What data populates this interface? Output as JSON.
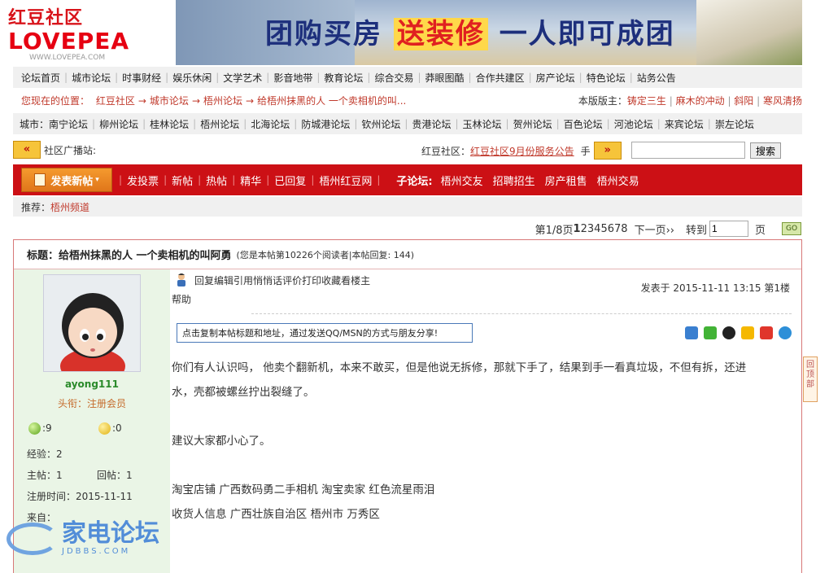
{
  "site": {
    "logo_cn": "红豆社区",
    "logo_en": "LOVEPEA",
    "logo_url": "WWW.LOVEPEA.COM"
  },
  "banner": {
    "slogan_a": "团购买房",
    "slogan_hl": "送装修",
    "slogan_b": "一人即可成团"
  },
  "main_nav": [
    "论坛首页",
    "城市论坛",
    "时事财经",
    "娱乐休闲",
    "文学艺术",
    "影音地带",
    "教育论坛",
    "综合交易",
    "莽眼图酷",
    "合作共建区",
    "房产论坛",
    "特色论坛",
    "站务公告"
  ],
  "breadcrumb": {
    "prefix": "您现在的位置：",
    "items": [
      "红豆社区",
      "城市论坛",
      "梧州论坛",
      "给梧州抹黑的人 一个卖相机的叫..."
    ],
    "arrow": "→",
    "moderator_label": "本版版主：",
    "moderators": [
      "铸定三生",
      "麻木的冲动",
      "斜阳",
      "寒风清扬"
    ]
  },
  "city_nav": {
    "label": "城市：",
    "items": [
      "南宁论坛",
      "柳州论坛",
      "桂林论坛",
      "梧州论坛",
      "北海论坛",
      "防城港论坛",
      "钦州论坛",
      "贵港论坛",
      "玉林论坛",
      "贺州论坛",
      "百色论坛",
      "河池论坛",
      "来宾论坛",
      "崇左论坛"
    ]
  },
  "broadcast": {
    "label": "社区广播站:",
    "right_label": "红豆社区：",
    "announcement": "红豆社区9月份服务公告",
    "hand": "手",
    "search_placeholder": "",
    "search_button": "搜索"
  },
  "toolbar": {
    "post_button": "发表新帖",
    "items": [
      "发投票",
      "新帖",
      "热帖",
      "精华",
      "已回复",
      "梧州红豆网"
    ],
    "sub_label": "子论坛:",
    "sub_items": [
      "梧州交友",
      "招聘招生",
      "房产租售",
      "梧州交易"
    ]
  },
  "recommend": {
    "label": "推荐：",
    "link": "梧州频道"
  },
  "pager": {
    "page_info": "第1/8页",
    "pages": [
      "1",
      "2",
      "3",
      "4",
      "5",
      "6",
      "7",
      "8"
    ],
    "next": "下一页››",
    "goto": "转到",
    "goto_value": "1",
    "page_suffix": "页",
    "go": "GO"
  },
  "post": {
    "title_label": "标题：",
    "title": "给梧州抹黑的人  一个卖相机的叫阿勇",
    "meta": "(您是本帖第10226个阅读者|本帖回复: 144)",
    "actions": [
      "回复",
      "编辑",
      "引用",
      "悄悄话",
      "评价",
      "打印",
      "收藏",
      "看楼主"
    ],
    "help": "帮助",
    "date": "发表于 2015-11-11 13:15 第1楼",
    "share_text": "点击复制本帖标题和地址，通过发送QQ/MSN的方式与朋友分享!",
    "body": [
      "你们有人认识吗，      他卖个翻新机，本来不敢买，但是他说无拆修，那就下手了，结果到手一看真垃圾，不但有拆，还进",
      "水，壳都被螺丝拧出裂缝了。",
      "",
      "建议大家都小心了。",
      "",
      "淘宝店铺 广西数码勇二手相机  淘宝卖家  红色流星雨泪",
      "收货人信息 广西壮族自治区 梧州市 万秀区"
    ]
  },
  "author": {
    "name": "ayong111",
    "title": "头衔：注册会员",
    "green_count": ":9",
    "yellow_count": ":0",
    "exp": "经验：2",
    "topics": "主帖：1",
    "replies": "回帖：1",
    "reg_date": "注册时间：2015-11-11",
    "from": "来自："
  },
  "back_top": "回顶部",
  "watermark": {
    "text": "家电论坛",
    "sub": "JDBBS.COM"
  },
  "colors": {
    "brand_red": "#cc1015",
    "link_red": "#c0392b",
    "side_green": "#eaf5e6"
  }
}
